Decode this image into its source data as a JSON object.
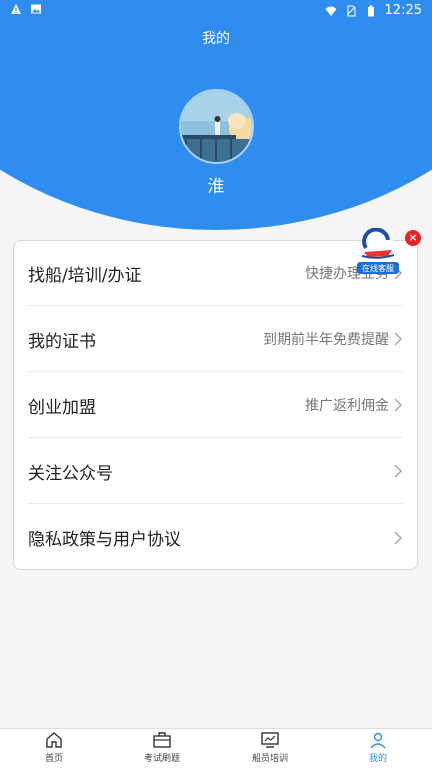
{
  "status_bar": {
    "time": "12:25"
  },
  "header": {
    "title": "我的",
    "username": "淮"
  },
  "floating_service": {
    "label": "在线客服",
    "close_glyph": "×"
  },
  "menu": [
    {
      "label": "找船/培训/办证",
      "hint": "快捷办理业务"
    },
    {
      "label": "我的证书",
      "hint": "到期前半年免费提醒"
    },
    {
      "label": "创业加盟",
      "hint": "推广返利佣金"
    },
    {
      "label": "关注公众号",
      "hint": ""
    },
    {
      "label": "隐私政策与用户协议",
      "hint": ""
    }
  ],
  "tabbar": [
    {
      "label": "首页",
      "icon": "home-icon"
    },
    {
      "label": "考试刷题",
      "icon": "briefcase-icon"
    },
    {
      "label": "船员培训",
      "icon": "monitor-chart-icon"
    },
    {
      "label": "我的",
      "icon": "user-icon",
      "active": true
    }
  ],
  "colors": {
    "accent": "#2f8df0",
    "close_red": "#e22222"
  }
}
